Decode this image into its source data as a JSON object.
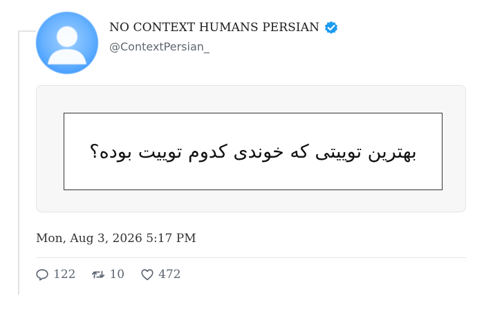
{
  "tweet": {
    "author": {
      "display_name": "NO CONTEXT HUMANS PERSIAN",
      "handle": "@ContextPersian_",
      "verified": true,
      "verified_color": "#1d9bf0"
    },
    "media_text": "بهترین توییتی که خوندی کدوم توییت بوده؟",
    "timestamp": "Mon, Aug 3, 2026 5:17 PM",
    "stats": {
      "replies": "122",
      "retweets": "10",
      "likes": "472"
    },
    "icons": {
      "avatar": "default-user-avatar",
      "verified": "verified-badge-icon",
      "reply": "reply-bubble-icon",
      "retweet": "retweet-arrows-icon",
      "like": "heart-icon"
    }
  }
}
